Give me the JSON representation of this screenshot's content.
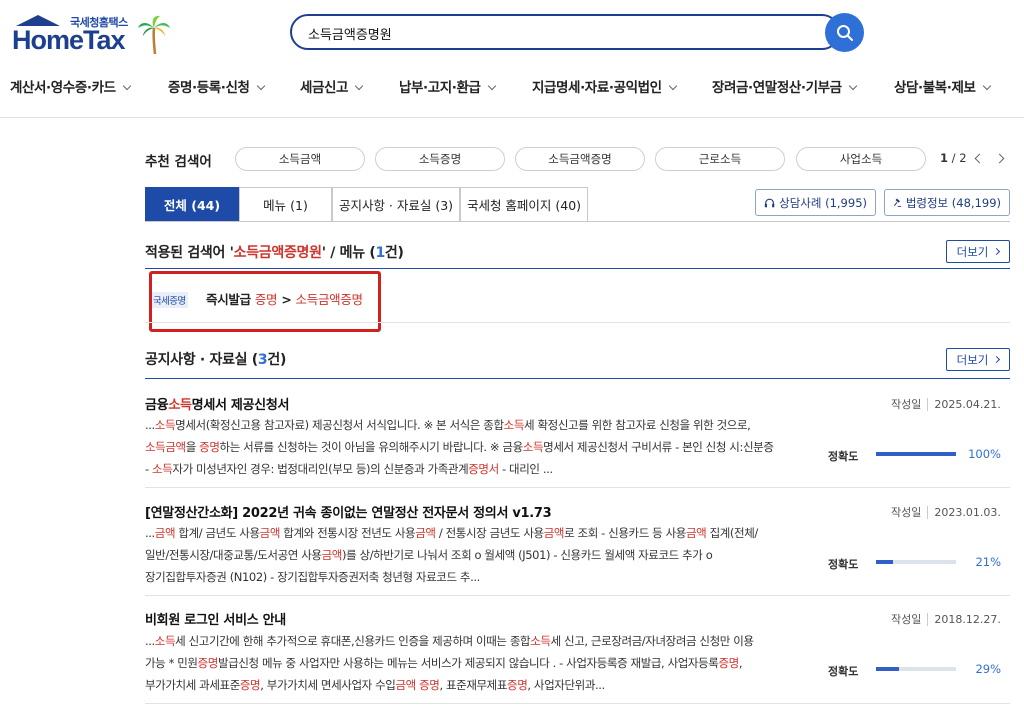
{
  "header": {
    "logo_top": "국세청홈택스",
    "logo_main": "HomeTax",
    "search_value": "소득금액증명원"
  },
  "gnb": [
    "계산서·영수증·카드",
    "증명·등록·신청",
    "세금신고",
    "납부·고지·환급",
    "지급명세·자료·공익법인",
    "장려금·연말정산·기부금",
    "상담·불복·제보"
  ],
  "recommended": {
    "label": "추천 검색어",
    "keywords": [
      "소득금액",
      "소득증명",
      "소득금액증명",
      "근로소득",
      "사업소득"
    ],
    "page_current": "1",
    "page_total": "/ 2"
  },
  "tabs": [
    {
      "label": "전체 (44)",
      "active": true
    },
    {
      "label": "메뉴 (1)",
      "active": false
    },
    {
      "label": "공지사항 · 자료실 (3)",
      "active": false
    },
    {
      "label": "국세청 홈페이지 (40)",
      "active": false
    }
  ],
  "info_buttons": {
    "consult": "상담사례 (1,995)",
    "law": "법령정보 (48,199)"
  },
  "menu_section": {
    "title_prefix": "적용된 검색어 '",
    "keyword": "소득금액증명원",
    "title_mid": "' / 메뉴 (",
    "count": "1",
    "title_suffix": "건)",
    "more": "더보기",
    "badge": "국세증명",
    "path_a": "즉시발급 ",
    "path_b": "증명",
    "path_c": " > ",
    "path_d": "소득금액증명"
  },
  "notice_section": {
    "title_prefix": "공지사항 · 자료실 (",
    "count": "3",
    "title_suffix": "건)",
    "more": "더보기",
    "date_label": "작성일",
    "accuracy_label": "정확도"
  },
  "notices": [
    {
      "title_a": "금융",
      "title_b": "소득",
      "title_c": "명세서 제공신청서",
      "date": "2025.04.21.",
      "accuracy": 100,
      "accuracy_text": "100%"
    },
    {
      "title": "[연말정산간소화] 2022년 귀속 종이없는 연말정산 전자문서 정의서 v1.73",
      "date": "2023.01.03.",
      "accuracy": 21,
      "accuracy_text": "21%"
    },
    {
      "title": "비회원 로그인 서비스 안내",
      "date": "2018.12.27.",
      "accuracy": 29,
      "accuracy_text": "29%"
    }
  ],
  "notice_bodies": {
    "n1_l1": [
      "...",
      "소득",
      "명세서(확정신고용 참고자료) 제공신청서 서식입니다. ※ 본 서식은 종합",
      "소득",
      "세 확정신고를 위한 참고자료 신청을 위한 것으로,"
    ],
    "n1_l2": [
      "소득금액",
      "을 ",
      "증명",
      "하는 서류를 신청하는 것이 아님을 유의해주시기 바랍니다. ※ 금융",
      "소득",
      "명세서 제공신청서 구비서류 - 본인 신청 시:신분증"
    ],
    "n1_l3": [
      "- ",
      "소득",
      "자가 미성년자인 경우: 법정대리인(부모 등)의 신분증과 가족관계",
      "증명서",
      " - 대리인 ..."
    ],
    "n2_l1": [
      "...",
      "금액",
      " 합계/ 금년도 사용",
      "금액",
      " 합계와 전통시장 전년도 사용",
      "금액",
      " / 전통시장 금년도 사용",
      "금액",
      "로 조회 - 신용카드 등 사용",
      "금액",
      " 집계(전체/"
    ],
    "n2_l2": [
      "일반/전통시장/대중교통/도서공연 사용",
      "금액",
      ")를 상/하반기로 나눠서 조회 o 월세액 (J501) - 신용카드 월세액 자료코드 추가 o"
    ],
    "n2_l3": [
      "장기집합투자증권 (N102) - 장기집합투자증권저축 청년형 자료코드 추..."
    ],
    "n3_l1": [
      "...",
      "소득",
      "세 신고기간에 한해 추가적으로 휴대폰,신용카드 인증을 제공하며 이때는 종합",
      "소득",
      "세 신고, 근로장려금/자녀장려금 신청만 이용"
    ],
    "n3_l2": [
      "가능 * 민원",
      "증명",
      "발급신청 메뉴 중 사업자만 사용하는 메뉴는 서비스가 제공되지 않습니다 . - 사업자등록증 재발급, 사업자등록",
      "증명",
      ","
    ],
    "n3_l3": [
      "부가가치세 과세표준",
      "증명",
      ", 부가가치세 면세사업자 수입",
      "금액",
      " ",
      "증명",
      ", 표준재무제표",
      "증명",
      ", 사업자단위과..."
    ]
  },
  "colors": {
    "brand": "#1e4aa8",
    "highlight": "#d0332c",
    "accent_blue": "#2f6fd8",
    "red_box": "#d0211f"
  }
}
